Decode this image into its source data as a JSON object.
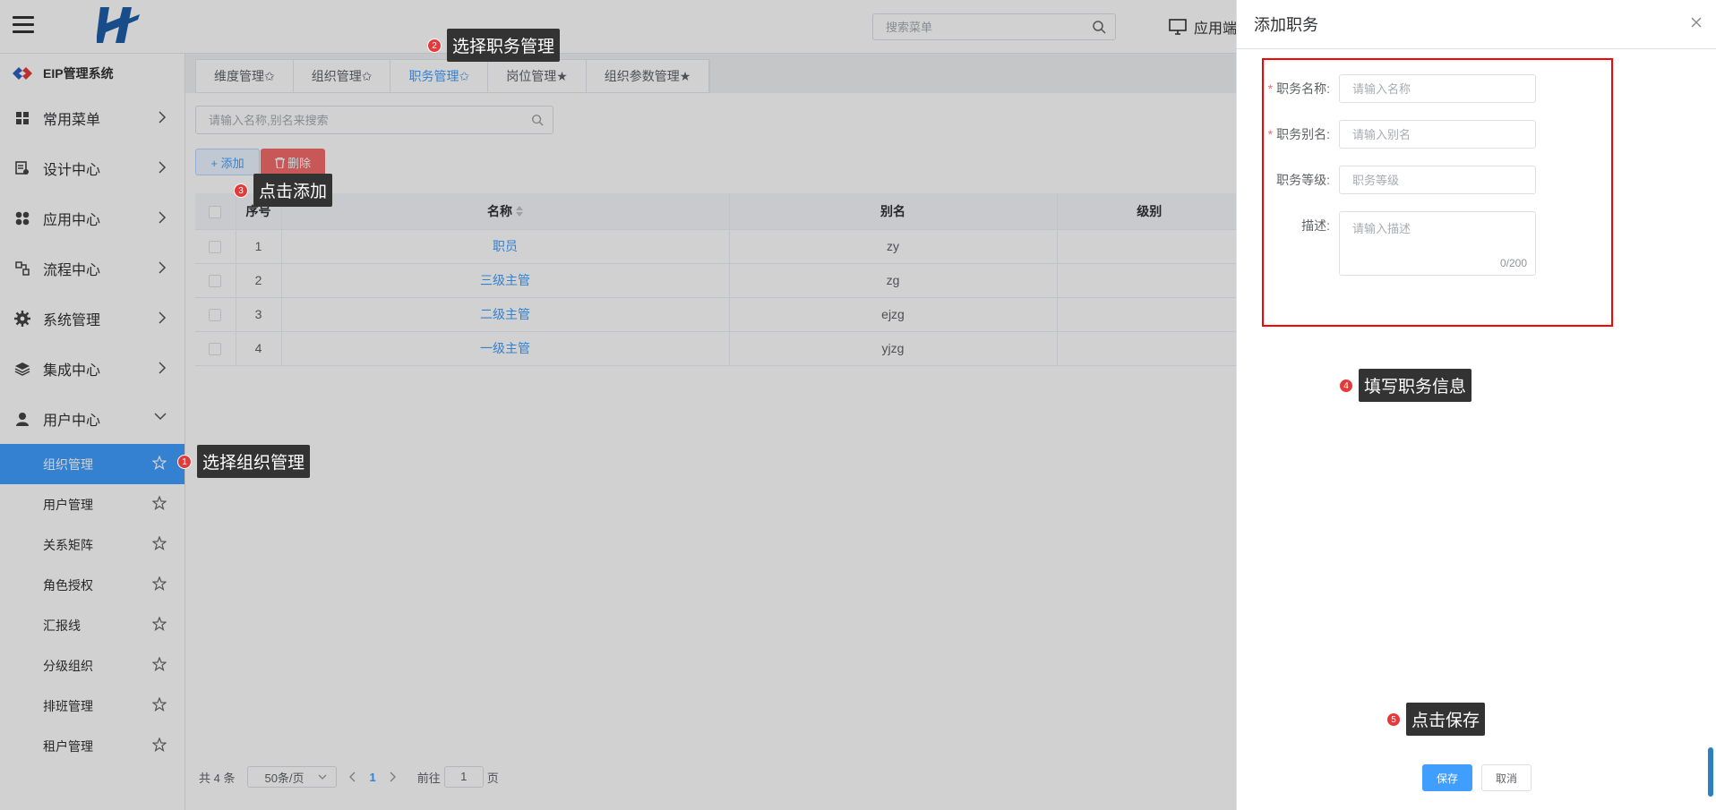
{
  "topbar": {
    "search_placeholder": "搜索菜单",
    "app_end_label": "应用端"
  },
  "sidebar": {
    "brand": "EIP管理系统",
    "menus": [
      {
        "label": "常用菜单",
        "icon": "grid-icon"
      },
      {
        "label": "设计中心",
        "icon": "design-icon"
      },
      {
        "label": "应用中心",
        "icon": "apps-icon"
      },
      {
        "label": "流程中心",
        "icon": "flow-icon"
      },
      {
        "label": "系统管理",
        "icon": "gear-icon"
      },
      {
        "label": "集成中心",
        "icon": "layers-icon"
      },
      {
        "label": "用户中心",
        "icon": "user-icon"
      }
    ],
    "sub_items": [
      "组织管理",
      "用户管理",
      "关系矩阵",
      "角色授权",
      "汇报线",
      "分级组织",
      "排班管理",
      "租户管理"
    ],
    "active_sub": "组织管理"
  },
  "tabs": [
    "维度管理✩",
    "组织管理✩",
    "职务管理✩",
    "岗位管理★",
    "组织参数管理★"
  ],
  "active_tab": "职务管理✩",
  "main": {
    "search_placeholder": "请输入名称,别名来搜索",
    "add_label": "+ 添加",
    "delete_label": "删除",
    "columns": [
      "序号",
      "名称",
      "别名",
      "级别"
    ],
    "rows": [
      {
        "no": "1",
        "name": "职员",
        "alias": "zy",
        "level": ""
      },
      {
        "no": "2",
        "name": "三级主管",
        "alias": "zg",
        "level": ""
      },
      {
        "no": "3",
        "name": "二级主管",
        "alias": "ejzg",
        "level": ""
      },
      {
        "no": "4",
        "name": "一级主管",
        "alias": "yjzg",
        "level": ""
      }
    ],
    "pager": {
      "total": "共 4 条",
      "page_size": "50条/页",
      "current": "1",
      "goto_prefix": "前往",
      "goto_value": "1",
      "goto_suffix": "页"
    }
  },
  "drawer": {
    "title": "添加职务",
    "fields": [
      {
        "label": "职务名称:",
        "placeholder": "请输入名称",
        "required": true
      },
      {
        "label": "职务别名:",
        "placeholder": "请输入别名",
        "required": true
      },
      {
        "label": "职务等级:",
        "placeholder": "职务等级",
        "required": false
      }
    ],
    "desc_label": "描述:",
    "desc_placeholder": "请输入描述",
    "desc_counter": "0/200",
    "save_label": "保存",
    "cancel_label": "取消"
  },
  "callouts": [
    {
      "num": "1",
      "text": "选择组织管理"
    },
    {
      "num": "2",
      "text": "选择职务管理"
    },
    {
      "num": "3",
      "text": "点击添加"
    },
    {
      "num": "4",
      "text": "填写职务信息"
    },
    {
      "num": "5",
      "text": "点击保存"
    }
  ],
  "colors": {
    "primary": "#409eff",
    "danger": "#f56c6c",
    "highlight_box": "#ff0000",
    "callout_badge": "#e6393a"
  }
}
